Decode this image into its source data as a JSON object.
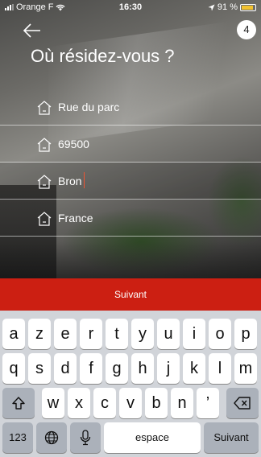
{
  "status_bar": {
    "carrier": "Orange F",
    "time": "16:30",
    "battery_percent": "91 %",
    "battery_level": 0.9
  },
  "header": {
    "back_icon": "arrow-left-icon",
    "step_number": "4",
    "title": "Où résidez-vous ?"
  },
  "form": {
    "fields": [
      {
        "icon": "house-icon",
        "value": "Rue du parc"
      },
      {
        "icon": "house-icon",
        "value": "69500"
      },
      {
        "icon": "house-icon",
        "value": "Bron"
      },
      {
        "icon": "house-icon",
        "value": "France"
      }
    ],
    "next_label": "Suivant"
  },
  "keyboard": {
    "row1": [
      "a",
      "z",
      "e",
      "r",
      "t",
      "y",
      "u",
      "i",
      "o",
      "p"
    ],
    "row2": [
      "q",
      "s",
      "d",
      "f",
      "g",
      "h",
      "j",
      "k",
      "l",
      "m"
    ],
    "row3": [
      "w",
      "x",
      "c",
      "v",
      "b",
      "n",
      "’"
    ],
    "shift_icon": "shift-icon",
    "delete_icon": "backspace-icon",
    "numbers_label": "123",
    "globe_icon": "globe-icon",
    "mic_icon": "microphone-icon",
    "space_label": "espace",
    "return_label": "Suivant"
  },
  "colors": {
    "accent": "#cc1f12",
    "battery": "#f2c230"
  }
}
